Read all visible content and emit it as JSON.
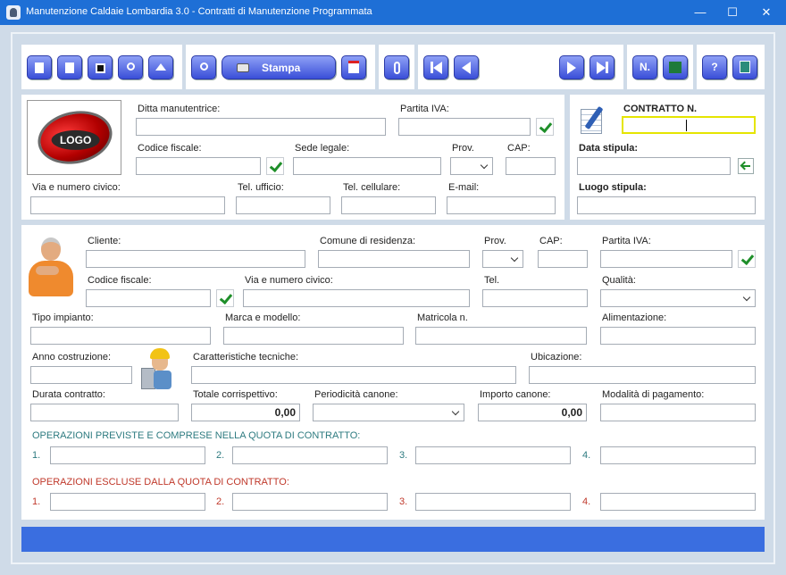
{
  "window": {
    "title": "Manutenzione Caldaie Lombardia 3.0 - Contratti di Manutenzione Programmata",
    "minimize": "—",
    "maximize": "☐",
    "close": "✕"
  },
  "toolbar": {
    "stampa_label": "Stampa",
    "numero_label": "N."
  },
  "ditta": {
    "logo_text": "LOGO",
    "ditta_manutentrice_label": "Ditta manutentrice:",
    "partita_iva_label": "Partita IVA:",
    "codice_fiscale_label": "Codice fiscale:",
    "sede_legale_label": "Sede legale:",
    "prov_label": "Prov.",
    "cap_label": "CAP:",
    "via_label": "Via e numero civico:",
    "tel_ufficio_label": "Tel. ufficio:",
    "tel_cellulare_label": "Tel. cellulare:",
    "email_label": "E-mail:"
  },
  "contratto": {
    "numero_label": "CONTRATTO N.",
    "data_stipula_label": "Data stipula:",
    "luogo_stipula_label": "Luogo stipula:"
  },
  "cliente": {
    "cliente_label": "Cliente:",
    "comune_label": "Comune di residenza:",
    "prov_label": "Prov.",
    "cap_label": "CAP:",
    "partita_iva_label": "Partita IVA:",
    "codice_fiscale_label": "Codice fiscale:",
    "via_label": "Via e numero civico:",
    "tel_label": "Tel.",
    "qualita_label": "Qualità:"
  },
  "impianto": {
    "tipo_label": "Tipo impianto:",
    "marca_label": "Marca e modello:",
    "matricola_label": "Matricola n.",
    "alimentazione_label": "Alimentazione:",
    "anno_label": "Anno costruzione:",
    "caratteristiche_label": "Caratteristiche tecniche:",
    "ubicazione_label": "Ubicazione:",
    "durata_label": "Durata contratto:",
    "totale_label": "Totale corrispettivo:",
    "totale_value": "0,00",
    "periodicita_label": "Periodicità canone:",
    "importo_label": "Importo canone:",
    "importo_value": "0,00",
    "modalita_label": "Modalità di pagamento:"
  },
  "operazioni": {
    "previste_heading": "OPERAZIONI PREVISTE E COMPRESE NELLA QUOTA DI CONTRATTO:",
    "escluse_heading": "OPERAZIONI ESCLUSE DALLA QUOTA DI CONTRATTO:",
    "numbers": [
      "1.",
      "2.",
      "3.",
      "4."
    ]
  },
  "colors": {
    "titlebar": "#1e6fd6",
    "button_blue": "#3a4fd8",
    "statusbar": "#3a6ee0",
    "check_green": "#1f8f2a"
  }
}
